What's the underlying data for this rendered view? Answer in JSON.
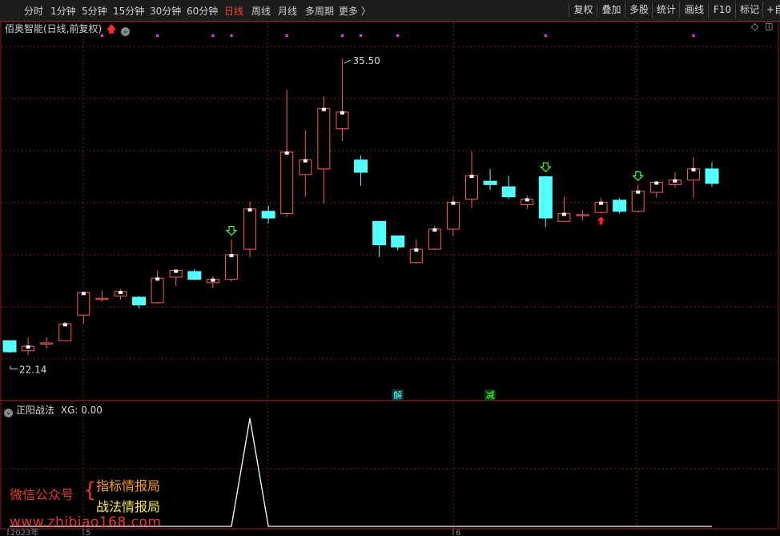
{
  "toolbar": {
    "periods": [
      {
        "label": "分时",
        "active": false
      },
      {
        "label": "1分钟",
        "active": false
      },
      {
        "label": "5分钟",
        "active": false
      },
      {
        "label": "15分钟",
        "active": false
      },
      {
        "label": "30分钟",
        "active": false
      },
      {
        "label": "60分钟",
        "active": false
      },
      {
        "label": "日线",
        "active": true
      },
      {
        "label": "周线",
        "active": false
      },
      {
        "label": "月线",
        "active": false
      },
      {
        "label": "多周期",
        "active": false
      },
      {
        "label": "更多 〉",
        "active": false
      }
    ],
    "tools": [
      "复权",
      "叠加",
      "多股",
      "统计",
      "画线",
      "F10",
      "标记",
      "+自"
    ]
  },
  "main_panel": {
    "stock_title": "佰奥智能(日线,前复权)",
    "high_label": "35.50",
    "low_label": "22.14",
    "event_markers": [
      {
        "index": 21,
        "text": "解"
      },
      {
        "index": 26,
        "text": "减"
      }
    ],
    "x_axis_labels": [
      {
        "index": 0,
        "text": "2023年"
      },
      {
        "index": 4,
        "text": "5"
      },
      {
        "index": 24,
        "text": "6"
      }
    ]
  },
  "indicator_panel": {
    "name": "正阳战法",
    "value_text": "XG: 0.00"
  },
  "watermark": {
    "line1_left": "微信公众号",
    "line1_right": "指标情报局",
    "line2_right": "战法情报局",
    "url": "www.zhibiao168.com"
  },
  "colors": {
    "up": "#ff5c5c",
    "down": "#54ffff",
    "grid": "#7a1f1f",
    "signal_down_arrow": "#3cff3c",
    "signal_up_arrow": "#ff2020",
    "dot": "#ff33ff",
    "indicator_line": "#ffffff"
  },
  "chart_data": {
    "type": "candlestick",
    "price_range": [
      21.6,
      36.4
    ],
    "candles": [
      {
        "o": 22.85,
        "h": 22.85,
        "l": 22.3,
        "c": 22.35
      },
      {
        "o": 22.4,
        "h": 23.0,
        "l": 22.2,
        "c": 22.6
      },
      {
        "o": 22.7,
        "h": 23.0,
        "l": 22.5,
        "c": 22.75
      },
      {
        "o": 22.85,
        "h": 23.7,
        "l": 22.85,
        "c": 23.6
      },
      {
        "o": 24.0,
        "h": 25.0,
        "l": 23.6,
        "c": 25.0
      },
      {
        "o": 24.7,
        "h": 25.1,
        "l": 24.6,
        "c": 24.75
      },
      {
        "o": 24.85,
        "h": 25.15,
        "l": 24.7,
        "c": 25.05
      },
      {
        "o": 24.8,
        "h": 24.85,
        "l": 24.3,
        "c": 24.45
      },
      {
        "o": 24.55,
        "h": 26.0,
        "l": 24.5,
        "c": 25.65
      },
      {
        "o": 25.7,
        "h": 26.0,
        "l": 25.3,
        "c": 26.0
      },
      {
        "o": 25.95,
        "h": 26.05,
        "l": 25.55,
        "c": 25.6
      },
      {
        "o": 25.45,
        "h": 25.75,
        "l": 25.2,
        "c": 25.6
      },
      {
        "o": 25.6,
        "h": 27.4,
        "l": 25.5,
        "c": 26.7
      },
      {
        "o": 26.95,
        "h": 29.1,
        "l": 26.6,
        "c": 28.75
      },
      {
        "o": 28.65,
        "h": 28.9,
        "l": 28.1,
        "c": 28.35
      },
      {
        "o": 28.55,
        "h": 34.1,
        "l": 28.4,
        "c": 31.3
      },
      {
        "o": 30.3,
        "h": 32.3,
        "l": 29.3,
        "c": 30.95
      },
      {
        "o": 30.55,
        "h": 33.8,
        "l": 29.0,
        "c": 33.25
      },
      {
        "o": 32.35,
        "h": 35.5,
        "l": 31.8,
        "c": 33.1
      },
      {
        "o": 30.95,
        "h": 31.15,
        "l": 29.8,
        "c": 30.4
      },
      {
        "o": 28.2,
        "h": 28.2,
        "l": 26.6,
        "c": 27.15
      },
      {
        "o": 27.55,
        "h": 27.55,
        "l": 26.9,
        "c": 27.05
      },
      {
        "o": 26.35,
        "h": 27.4,
        "l": 26.3,
        "c": 26.95
      },
      {
        "o": 26.95,
        "h": 28.0,
        "l": 26.9,
        "c": 27.85
      },
      {
        "o": 27.85,
        "h": 29.3,
        "l": 27.55,
        "c": 29.05
      },
      {
        "o": 29.2,
        "h": 31.35,
        "l": 28.8,
        "c": 30.25
      },
      {
        "o": 30.0,
        "h": 30.55,
        "l": 29.6,
        "c": 29.85
      },
      {
        "o": 29.75,
        "h": 30.25,
        "l": 29.2,
        "c": 29.3
      },
      {
        "o": 28.95,
        "h": 29.35,
        "l": 28.75,
        "c": 29.2
      },
      {
        "o": 30.2,
        "h": 30.25,
        "l": 27.95,
        "c": 28.35
      },
      {
        "o": 28.2,
        "h": 29.3,
        "l": 28.2,
        "c": 28.55
      },
      {
        "o": 28.45,
        "h": 28.7,
        "l": 28.25,
        "c": 28.5
      },
      {
        "o": 28.6,
        "h": 29.25,
        "l": 28.55,
        "c": 29.05
      },
      {
        "o": 29.15,
        "h": 29.25,
        "l": 28.55,
        "c": 28.65
      },
      {
        "o": 28.65,
        "h": 29.85,
        "l": 28.6,
        "c": 29.55
      },
      {
        "o": 29.5,
        "h": 30.0,
        "l": 29.25,
        "c": 29.95
      },
      {
        "o": 29.85,
        "h": 30.4,
        "l": 29.7,
        "c": 30.05
      },
      {
        "o": 30.05,
        "h": 31.1,
        "l": 29.25,
        "c": 30.55
      },
      {
        "o": 30.55,
        "h": 30.85,
        "l": 29.75,
        "c": 29.9
      }
    ],
    "buy_signals_down_arrow": [
      12,
      29,
      34
    ],
    "up_arrow_signals": [
      32
    ],
    "dot_markers": [
      5,
      8,
      11,
      12,
      15,
      18,
      19,
      21,
      29,
      37
    ],
    "indicator": {
      "name": "正阳战法",
      "series": "XG",
      "peak_index": 13,
      "peak_value": 1,
      "range": [
        0,
        1
      ]
    }
  }
}
